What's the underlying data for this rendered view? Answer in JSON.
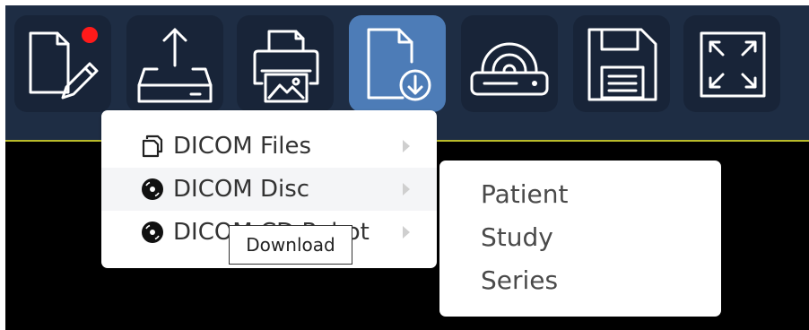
{
  "colors": {
    "toolbar_bg": "#1e2d44",
    "button_bg": "#182438",
    "button_active_bg": "#4d7cb7",
    "accent_line": "#b9bb2a",
    "notification_dot": "#ff1a1a",
    "viewport_bg": "#000000"
  },
  "toolbar": {
    "buttons": [
      {
        "icon": "edit-document-icon",
        "active": false,
        "notification": true
      },
      {
        "icon": "upload-icon",
        "active": false
      },
      {
        "icon": "print-icon",
        "active": false
      },
      {
        "icon": "download-document-icon",
        "active": true
      },
      {
        "icon": "disc-drive-icon",
        "active": false
      },
      {
        "icon": "save-icon",
        "active": false
      },
      {
        "icon": "fullscreen-icon",
        "active": false
      }
    ]
  },
  "download_menu": {
    "items": [
      {
        "icon": "copy-files-icon",
        "label": "DICOM Files",
        "has_submenu": true
      },
      {
        "icon": "disc-icon",
        "label": "DICOM Disc",
        "has_submenu": true,
        "hovered": true
      },
      {
        "icon": "disc-icon",
        "label": "DICOM CD Robot",
        "has_submenu": true
      }
    ]
  },
  "submenu": {
    "items": [
      "Patient",
      "Study",
      "Series"
    ]
  },
  "tooltip": {
    "text": "Download"
  }
}
